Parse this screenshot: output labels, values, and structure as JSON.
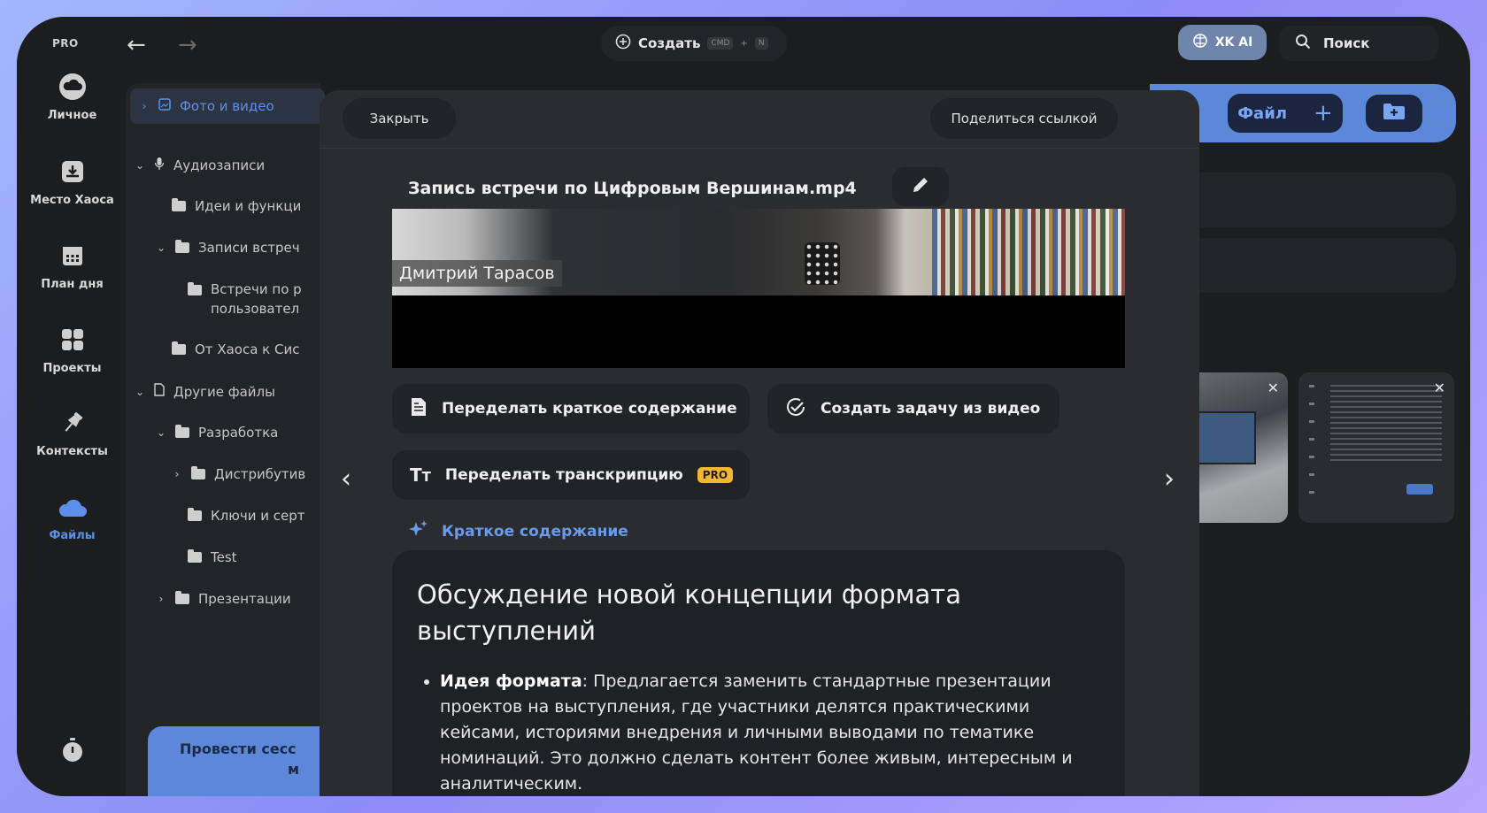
{
  "app": {
    "plan_label": "PRO"
  },
  "rail": {
    "items": [
      {
        "label": "Личное",
        "icon": "cloud-icon"
      },
      {
        "label": "Место Хаоса",
        "icon": "inbox-icon"
      },
      {
        "label": "План дня",
        "icon": "calendar-icon"
      },
      {
        "label": "Проекты",
        "icon": "grid-icon"
      },
      {
        "label": "Контексты",
        "icon": "pin-icon"
      },
      {
        "label": "Файлы",
        "icon": "cloud-icon",
        "active": true
      }
    ],
    "timer_icon": "timer-icon"
  },
  "topbar": {
    "create_label": "Создать",
    "create_shortcut_mod": "CMD",
    "create_shortcut_plus": "+",
    "create_shortcut_key": "N",
    "ai_label": "XK AI",
    "search_label": "Поиск"
  },
  "tree": {
    "items": [
      {
        "label": "Фото и видео",
        "chevron": "›"
      },
      {
        "label": "Аудиозаписи",
        "chevron": "⌄"
      },
      {
        "label": "Идеи и функци"
      },
      {
        "label": "Записи встреч",
        "chevron": "⌄"
      },
      {
        "label": "Встречи по р",
        "label2": "пользовател"
      },
      {
        "label": "От Хаоса к Сис"
      },
      {
        "label": "Другие файлы",
        "chevron": "⌄"
      },
      {
        "label": "Разработка",
        "chevron": "⌄"
      },
      {
        "label": "Дистрибутив",
        "chevron": "›"
      },
      {
        "label": "Ключи и серт"
      },
      {
        "label": "Test"
      },
      {
        "label": "Презентации",
        "chevron": "›"
      }
    ],
    "session_card_line1": "Провести сесс",
    "session_card_line2": "м"
  },
  "background_panel": {
    "file_button": "Файл",
    "file_plus": "+"
  },
  "modal": {
    "close_label": "Закрыть",
    "share_label": "Поделиться ссылкой",
    "file_title": "Запись встречи по Цифровым Вершинам.mp4",
    "video_name_tag": "Дмитрий Тарасов",
    "actions": {
      "redo_summary": "Переделать краткое содержание",
      "create_task": "Создать задачу из видео",
      "redo_transcript": "Переделать транскрипцию",
      "pro_badge": "PRO"
    },
    "summary_heading": "Краткое содержание",
    "summary_title": "Обсуждение новой концепции формата выступлений",
    "summary_items": [
      {
        "term": "Идея формата",
        "text": ": Предлагается заменить стандартные презентации проектов на выступления, где участники делятся практическими кейсами, историями внедрения и личными выводами по тематике номинаций. Это должно сделать контент более живым, интересным и аналитическим."
      }
    ]
  },
  "colors": {
    "accent": "#5e8fe8",
    "pro_badge": "#f2b730",
    "window_bg": "#1c1d1f",
    "modal_bg": "#2b2c2f"
  }
}
